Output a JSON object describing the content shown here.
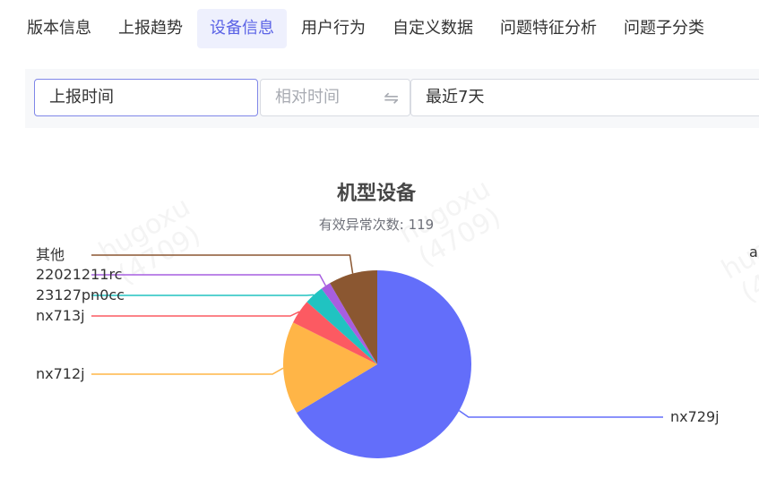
{
  "tabs": [
    {
      "label": "版本信息",
      "active": false
    },
    {
      "label": "上报趋势",
      "active": false
    },
    {
      "label": "设备信息",
      "active": true
    },
    {
      "label": "用户行为",
      "active": false
    },
    {
      "label": "自定义数据",
      "active": false
    },
    {
      "label": "问题特征分析",
      "active": false
    },
    {
      "label": "问题子分类",
      "active": false
    }
  ],
  "filter": {
    "field": "上报时间",
    "mode_placeholder": "相对时间",
    "mode_icon": "swap-icon",
    "range": "最近7天"
  },
  "watermark": {
    "name": "hugoxu",
    "id": "(4709)"
  },
  "chart_data": {
    "type": "pie",
    "title": "机型设备",
    "subtitle": "有效异常次数: 119",
    "start_angle_deg": 90,
    "clockwise": true,
    "slices": [
      {
        "name": "nx729j",
        "value": 79,
        "color": "#636efa"
      },
      {
        "name": "nx712j",
        "value": 19,
        "color": "#ffb547"
      },
      {
        "name": "nx713j",
        "value": 5,
        "color": "#fc5a62"
      },
      {
        "name": "23127pn0cc",
        "value": 4,
        "color": "#20c3c1"
      },
      {
        "name": "22021211rc",
        "value": 2,
        "color": "#a75ee0"
      },
      {
        "name": "其他",
        "value": 10,
        "color": "#8b5731"
      }
    ],
    "label_cut_off": "a"
  }
}
